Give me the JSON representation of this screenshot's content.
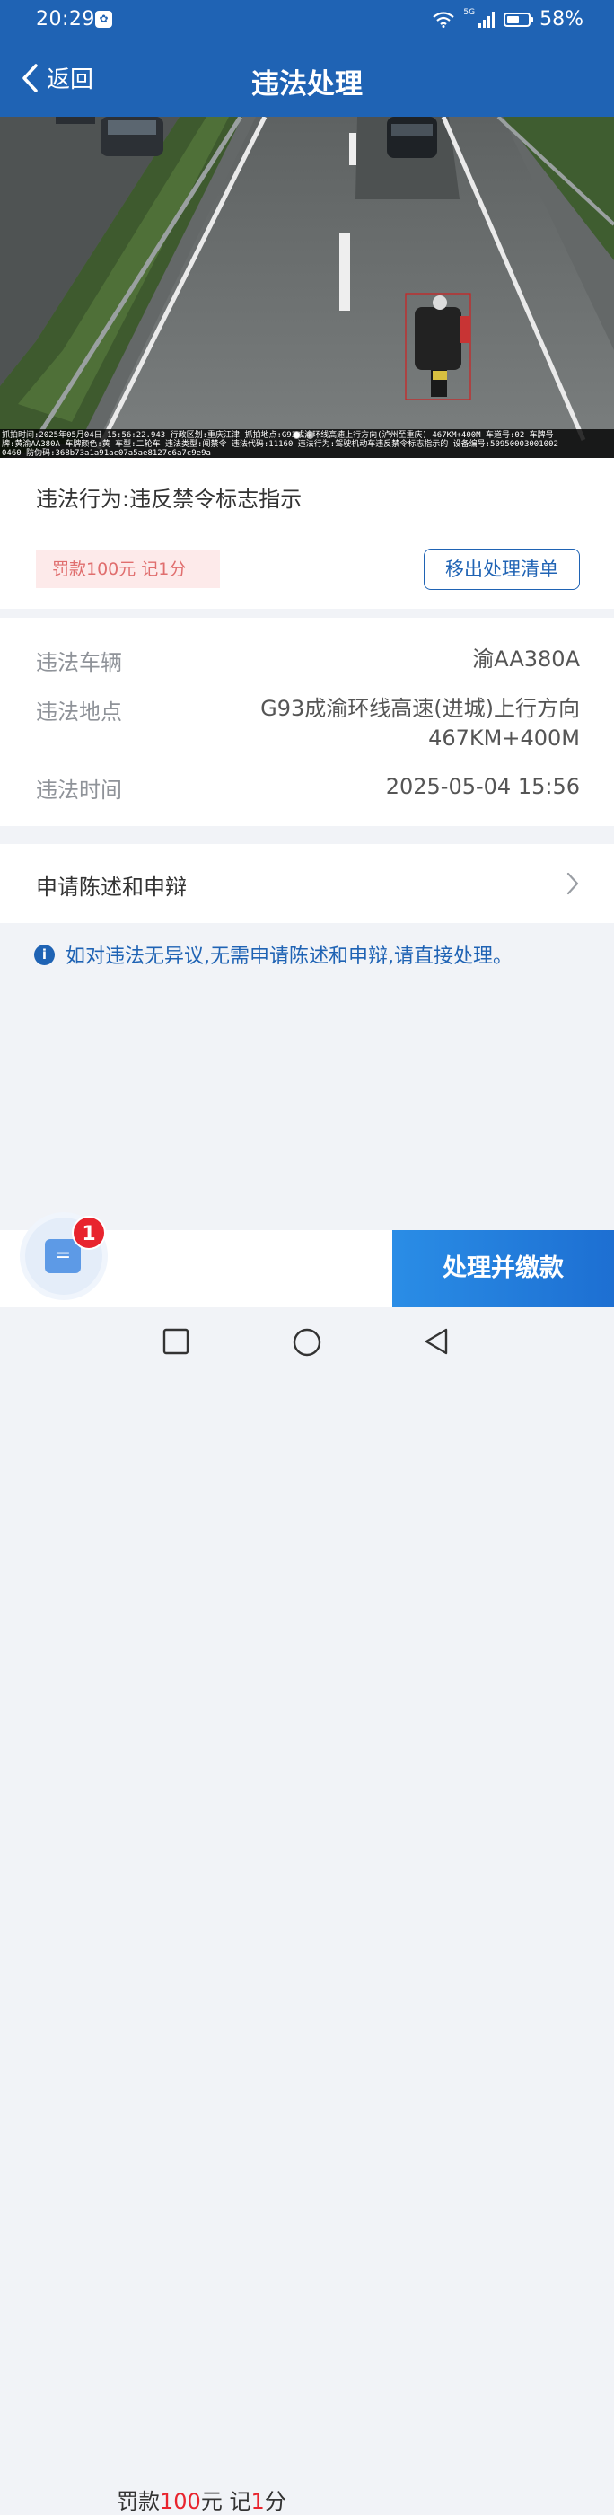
{
  "status_bar": {
    "time": "20:29",
    "network": "5G",
    "battery": "58%",
    "battery_level": 0.58
  },
  "header": {
    "back_label": "返回",
    "title": "违法处理"
  },
  "photo": {
    "caption_line1": "抓拍时间:2025年05月04日 15:56:22.943 行政区划:重庆江津 抓拍地点:G93成渝环线高速上行方向(泸州至重庆) 467KM+400M 车道号:02 车牌号",
    "caption_line2": "牌:黄渝AA380A 车牌颜色:黄 车型:二轮车 违法类型:闯禁令 违法代码:11160 违法行为:驾驶机动车违反禁令标志指示的 设备编号:50950003001002",
    "caption_line3": "0460 防伪码:368b73a1a91ac07a5ae8127c6a7c9e9a",
    "slides": 2,
    "active_slide": 1
  },
  "violation": {
    "behavior_label": "违法行为:",
    "behavior_value": "违反禁令标志指示",
    "fine_tag": "罚款100元 记1分",
    "remove_button": "移出处理清单"
  },
  "details": {
    "vehicle_label": "违法车辆",
    "vehicle_value": "渝AA380A",
    "location_label": "违法地点",
    "location_line1": "G93成渝环线高速(进城)上行方向",
    "location_line2": "467KM+400M",
    "time_label": "违法时间",
    "time_value": "2025-05-04 15:56"
  },
  "appeal": {
    "label": "申请陈述和申辩"
  },
  "notice": {
    "text": "如对违法无异议,无需申请陈述和申辩,请直接处理。"
  },
  "bottom_bar": {
    "badge_count": "1",
    "summary_prefix": "罚款",
    "fine_amount": "100",
    "fine_unit": "元 记",
    "points": "1",
    "points_unit": "分",
    "pay_button": "处理并缴款"
  },
  "colors": {
    "brand": "#1f63b4",
    "accent_red": "#e8242e",
    "pay_button": "#2a8de6"
  }
}
